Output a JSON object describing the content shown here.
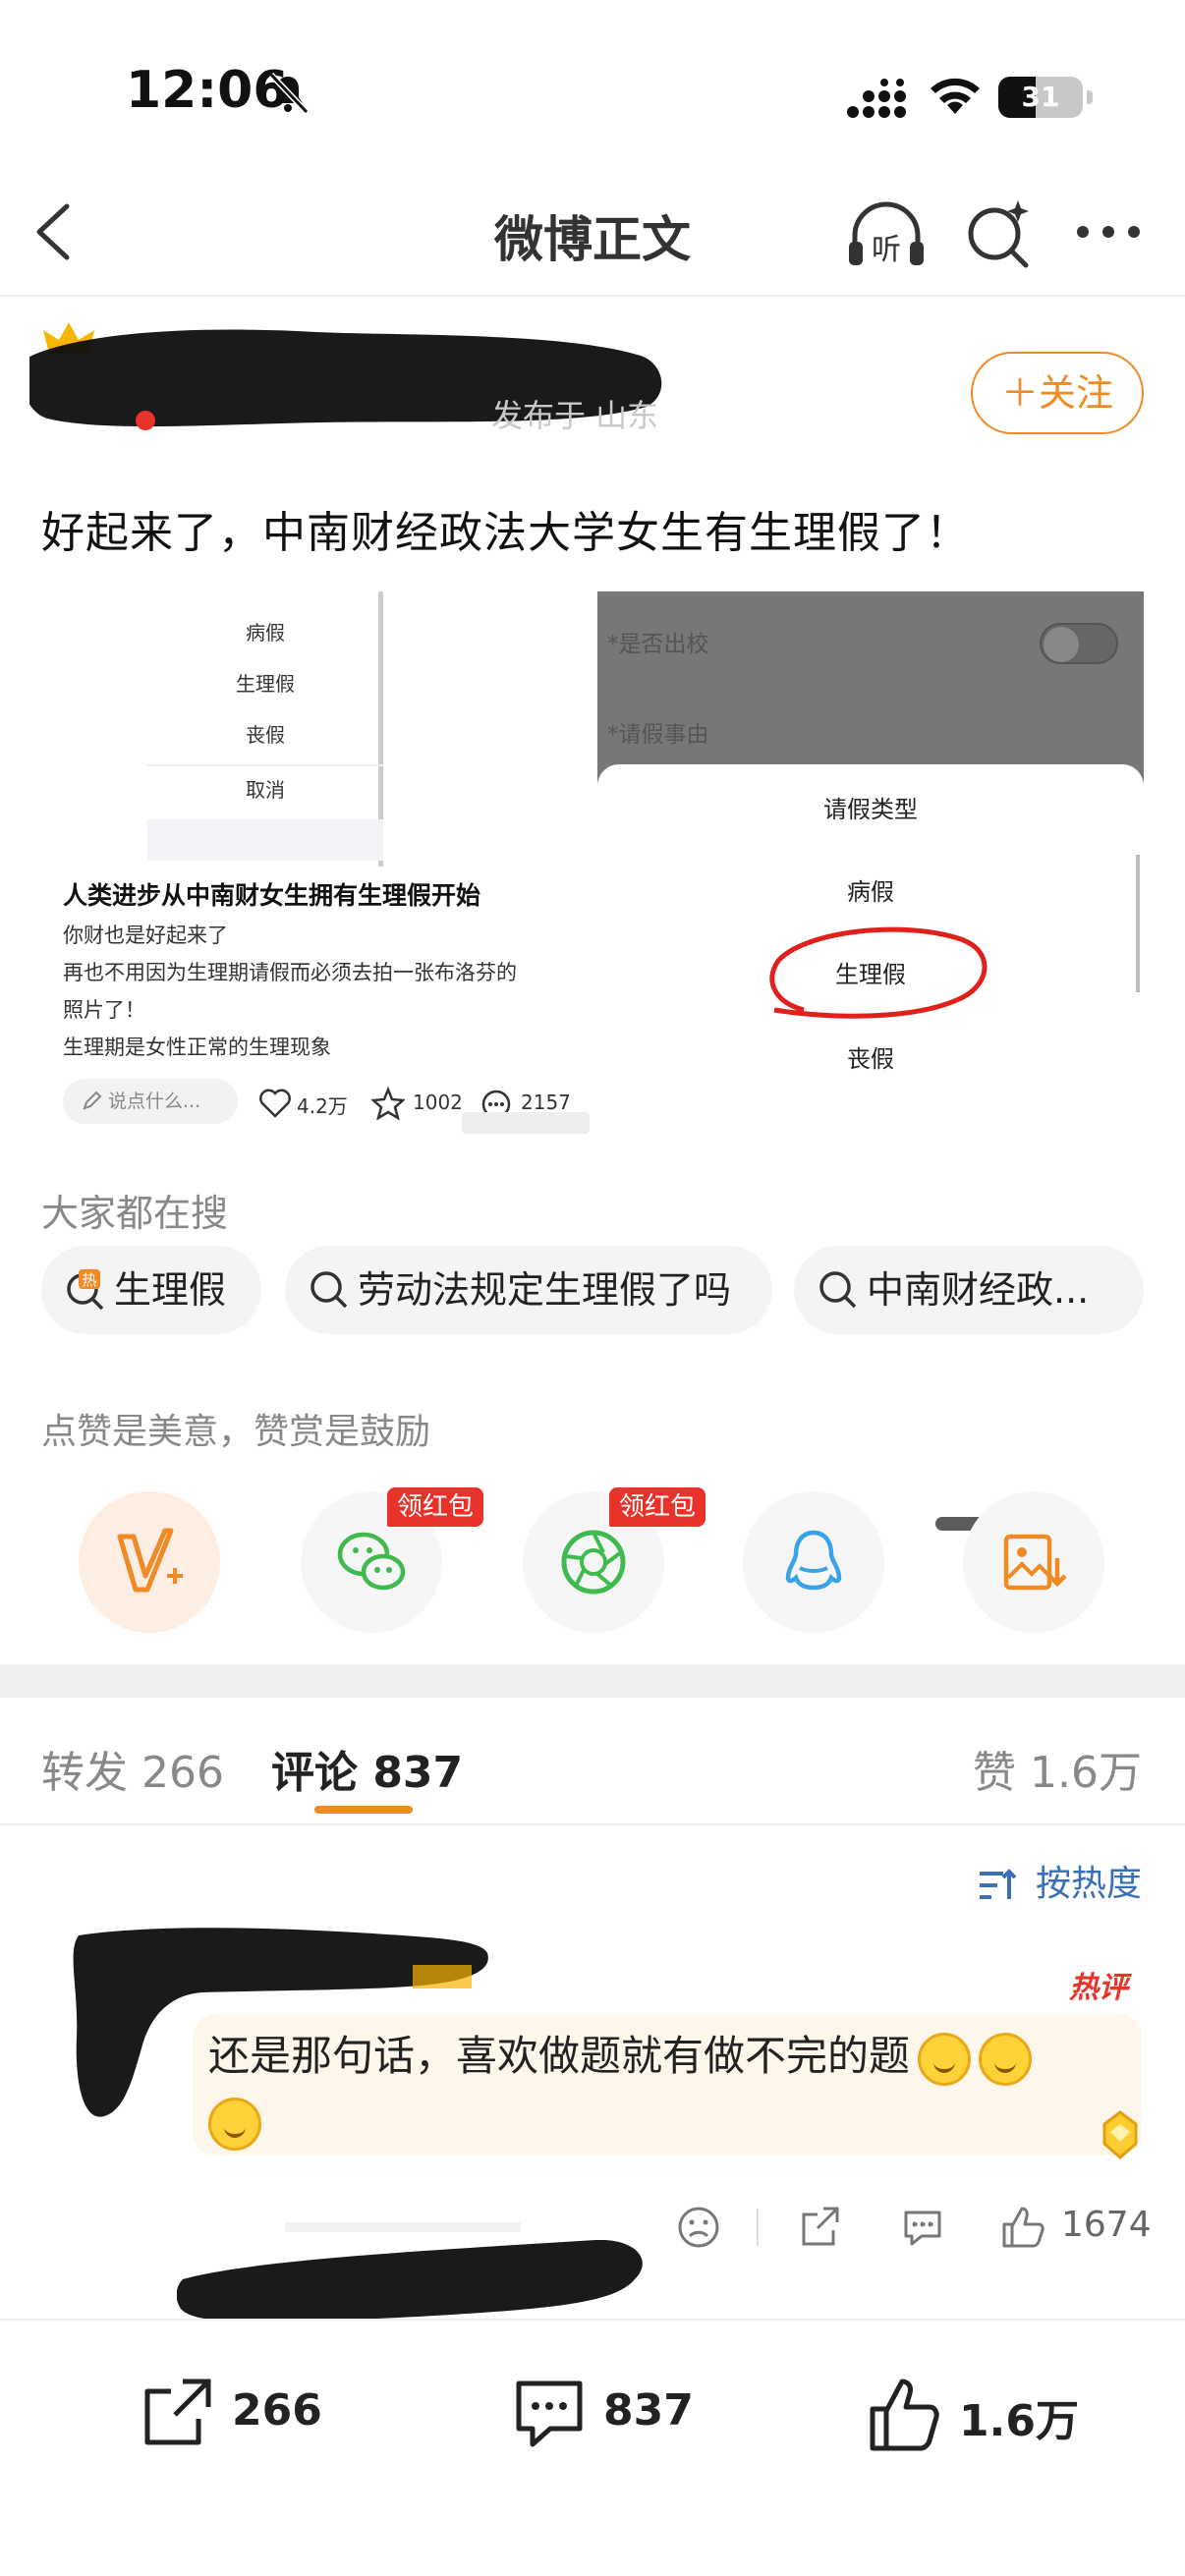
{
  "status_bar": {
    "time": "12:06",
    "battery": "31"
  },
  "nav": {
    "title": "微博正文"
  },
  "post": {
    "follow_label": "＋关注",
    "meta_text": "发布于 山东",
    "text": "好起来了，中南财经政法大学女生有生理假了！",
    "image_left": {
      "menu_items": [
        "病假",
        "生理假",
        "丧假",
        "取消"
      ],
      "headline": "人类进步从中南财女生拥有生理假开始",
      "lines": [
        "你财也是好起来了",
        "再也不用因为生理期请假而必须去拍一张布洛芬的",
        "照片了！",
        "生理期是女性正常的生理现象"
      ],
      "input_placeholder": "说点什么...",
      "likes": "4.2万",
      "favs": "1002",
      "comments": "2157"
    },
    "image_right": {
      "field1": "*是否出校",
      "field2": "*请假事由",
      "sheet_title": "请假类型",
      "options": [
        "病假",
        "生理假",
        "丧假"
      ]
    }
  },
  "hot_search": {
    "label": "大家都在搜",
    "chips": [
      "生理假",
      "劳动法规定生理假了吗",
      "中南财经政..."
    ]
  },
  "praise": {
    "label": "点赞是美意，赞赏是鼓励",
    "badge": "领红包"
  },
  "tabs": {
    "repost": "转发 266",
    "comment": "评论 837",
    "like": "赞 1.6万"
  },
  "sort_label": "按热度",
  "comment": {
    "hot_label": "热评",
    "text": "还是那句话，喜欢做题就有做不完的题",
    "likes": "1674"
  },
  "bottom_bar": {
    "repost": "266",
    "comment": "837",
    "like": "1.6万"
  },
  "colors": {
    "accent": "#f08a24",
    "red": "#e8322a",
    "link": "#3a6fb5"
  }
}
